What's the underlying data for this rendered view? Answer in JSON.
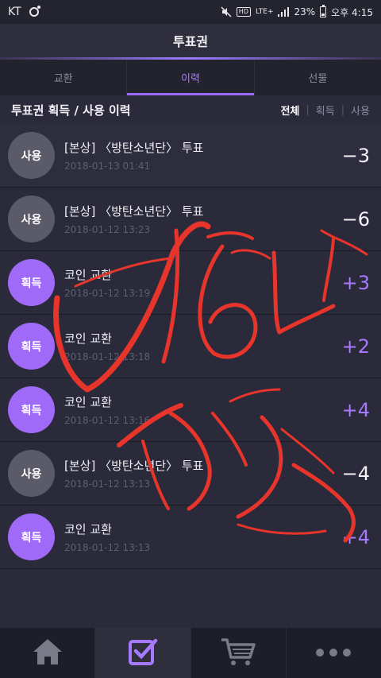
{
  "status_bar": {
    "carrier": "KT",
    "network": "LTE+",
    "battery": "23%",
    "time": "오후 4:15"
  },
  "header": {
    "title": "투표권"
  },
  "tabs": [
    {
      "label": "교환",
      "active": false
    },
    {
      "label": "이력",
      "active": true
    },
    {
      "label": "선물",
      "active": false
    }
  ],
  "section": {
    "title": "투표권 획득 / 사용 이력",
    "filters": [
      {
        "label": "전체",
        "active": true
      },
      {
        "label": "획득",
        "active": false
      },
      {
        "label": "사용",
        "active": false
      }
    ]
  },
  "history": [
    {
      "type": "use",
      "badge": "사용",
      "title": "[본상] 〈방탄소년단〉 투표",
      "datetime": "2018-01-13 01:41",
      "amount": "−3"
    },
    {
      "type": "use",
      "badge": "사용",
      "title": "[본상] 〈방탄소년단〉 투표",
      "datetime": "2018-01-12 13:23",
      "amount": "−6"
    },
    {
      "type": "gain",
      "badge": "획득",
      "title": "코인 교환",
      "datetime": "2018-01-12 13:19",
      "amount": "+3"
    },
    {
      "type": "gain",
      "badge": "획득",
      "title": "코인 교환",
      "datetime": "2018-01-12 13:18",
      "amount": "+2"
    },
    {
      "type": "gain",
      "badge": "획득",
      "title": "코인 교환",
      "datetime": "2018-01-12 13:16",
      "amount": "+4"
    },
    {
      "type": "use",
      "badge": "사용",
      "title": "[본상] 〈방탄소년단〉 투표",
      "datetime": "2018-01-12 13:13",
      "amount": "−4"
    },
    {
      "type": "gain",
      "badge": "획득",
      "title": "코인 교환",
      "datetime": "2018-01-12 13:13",
      "amount": "+4"
    }
  ],
  "bottom_nav": [
    {
      "icon": "home-icon",
      "active": false
    },
    {
      "icon": "vote-check-icon",
      "active": true
    },
    {
      "icon": "cart-icon",
      "active": false
    },
    {
      "icon": "more-icon",
      "active": false
    }
  ],
  "colors": {
    "accent": "#a779ff",
    "gain_badge": "#a06af8",
    "use_badge": "#5a5a68",
    "scribble": "#e8352b"
  }
}
